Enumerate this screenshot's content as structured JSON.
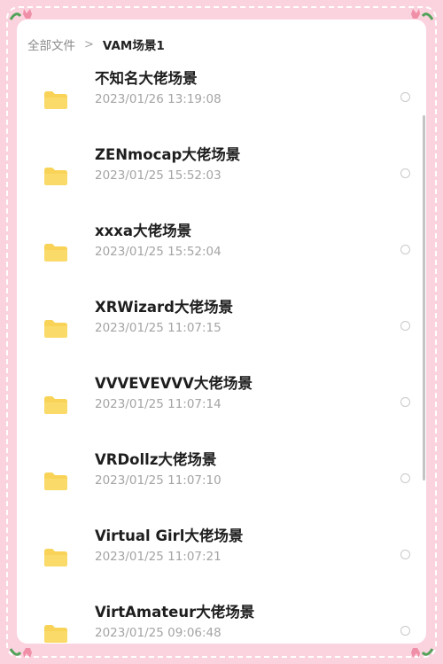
{
  "breadcrumb": {
    "root": "全部文件",
    "separator": ">",
    "current": "VAM场景1"
  },
  "folders": [
    {
      "name": "不知名大佬场景",
      "date": "2023/01/26 13:19:08"
    },
    {
      "name": "ZENmocap大佬场景",
      "date": "2023/01/25 15:52:03"
    },
    {
      "name": "xxxa大佬场景",
      "date": "2023/01/25 15:52:04"
    },
    {
      "name": "XRWizard大佬场景",
      "date": "2023/01/25 11:07:15"
    },
    {
      "name": "VVVEVEVVV大佬场景",
      "date": "2023/01/25 11:07:14"
    },
    {
      "name": "VRDollz大佬场景",
      "date": "2023/01/25 11:07:10"
    },
    {
      "name": "Virtual Girl大佬场景",
      "date": "2023/01/25 11:07:21"
    },
    {
      "name": "VirtAmateur大佬场景",
      "date": "2023/01/25 09:06:48"
    }
  ],
  "icons": {
    "folder": "folder-icon",
    "select": "radio-circle-icon",
    "decoration": "tulip-icon"
  },
  "colors": {
    "frame_pink": "#fbd3df",
    "folder_yellow": "#f8d357",
    "text_dark": "#1e1e1e",
    "text_muted": "#a4a4a4"
  }
}
